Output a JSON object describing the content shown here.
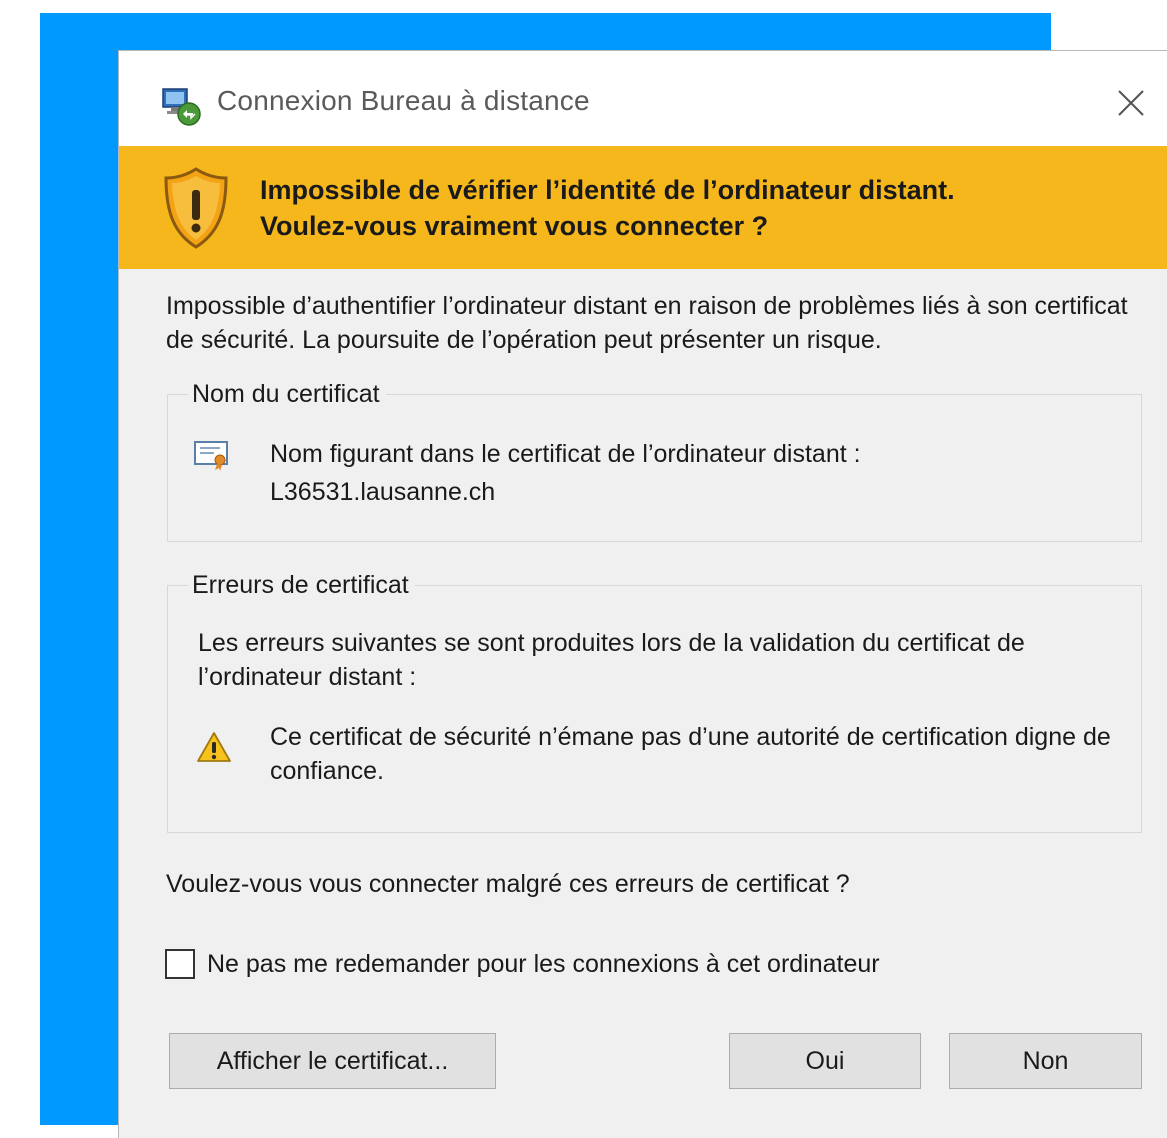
{
  "window": {
    "title": "Connexion Bureau à distance",
    "app_icon": "remote-desktop-icon",
    "close_icon": "close-icon"
  },
  "banner": {
    "icon": "shield-warning-icon",
    "line1": "Impossible de vérifier l’identité de l’ordinateur distant.",
    "line2": "Voulez-vous vraiment vous connecter ?",
    "color": "#f6b71c"
  },
  "intro_text": "Impossible d’authentifier l’ordinateur distant en raison de problèmes liés à son certificat de sécurité. La poursuite de l’opération peut présenter un risque.",
  "certificate_name": {
    "legend": "Nom du certificat",
    "icon": "certificate-icon",
    "label": "Nom figurant dans le certificat de l’ordinateur distant :",
    "value": "L36531.lausanne.ch"
  },
  "certificate_errors": {
    "legend": "Erreurs de certificat",
    "intro": "Les erreurs suivantes se sont produites lors de la validation du certificat de l’ordinateur distant :",
    "items": [
      {
        "icon": "warning-icon",
        "text": "Ce certificat de sécurité n’émane pas d’une autorité de certification digne de confiance."
      }
    ]
  },
  "question": "Voulez-vous vous connecter malgré ces erreurs de certificat ?",
  "checkbox": {
    "label": "Ne pas me redemander pour les connexions à cet ordinateur",
    "checked": false
  },
  "buttons": {
    "view_certificate": "Afficher le certificat...",
    "yes": "Oui",
    "no": "Non"
  }
}
